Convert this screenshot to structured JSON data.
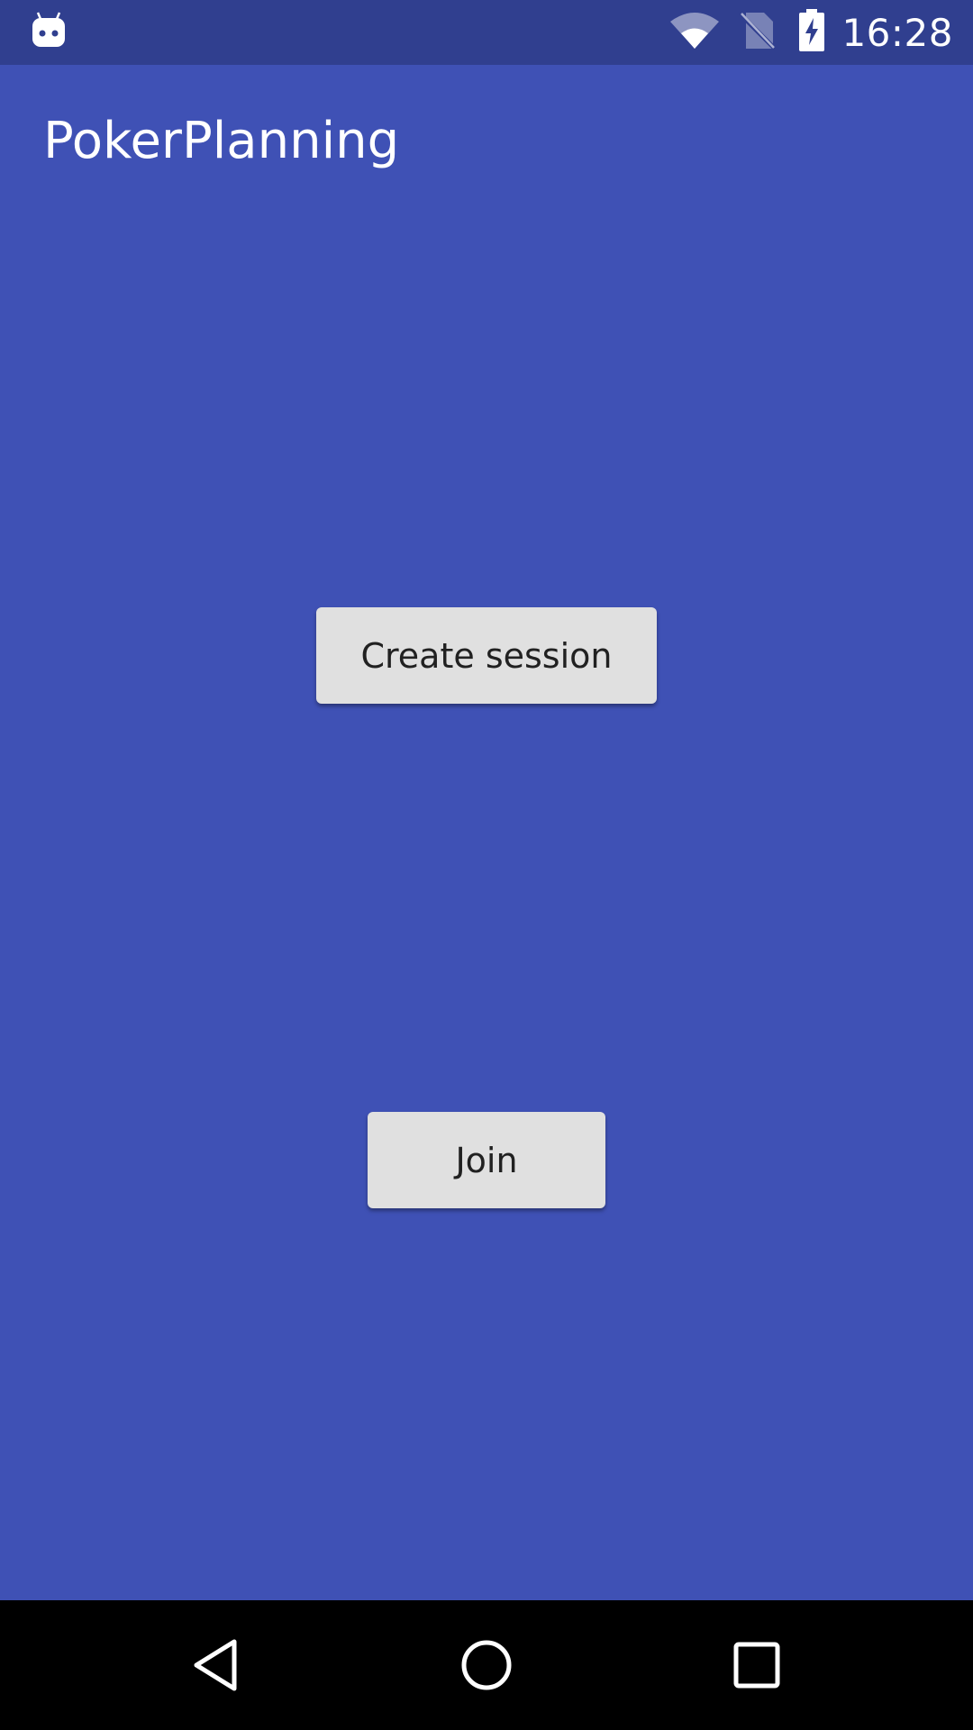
{
  "status_bar": {
    "time": "16:28",
    "icons": [
      "android-debug-icon",
      "wifi-icon",
      "no-sim-icon",
      "battery-charging-icon"
    ]
  },
  "app_bar": {
    "title": "PokerPlanning"
  },
  "main": {
    "create_session_label": "Create session",
    "join_label": "Join"
  },
  "nav_bar": {
    "icons": [
      "back-icon",
      "home-icon",
      "recents-icon"
    ]
  },
  "colors": {
    "primary": "#3F51B5",
    "primary_dark": "#303F8F",
    "button_bg": "#E0E0E0",
    "button_text": "#212121"
  }
}
